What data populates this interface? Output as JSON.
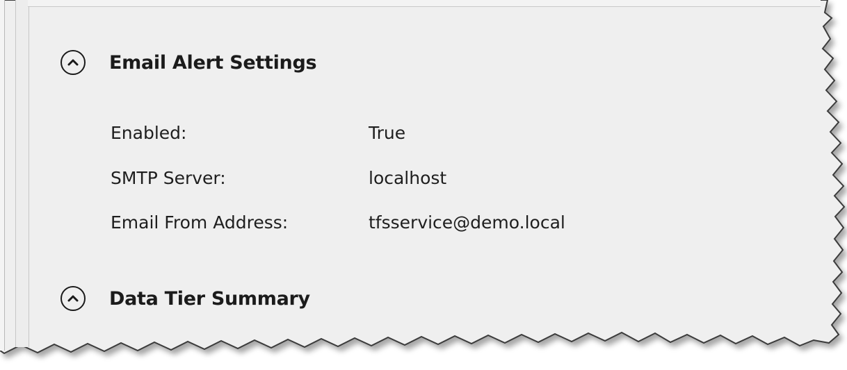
{
  "sections": [
    {
      "title": "Email Alert Settings",
      "expanded": true,
      "icon": "chevron-up-icon",
      "properties": [
        {
          "label": "Enabled:",
          "value": "True"
        },
        {
          "label": "SMTP Server:",
          "value": "localhost"
        },
        {
          "label": "Email From Address:",
          "value": "tfsservice@demo.local"
        }
      ]
    },
    {
      "title": "Data Tier Summary",
      "expanded": true,
      "icon": "chevron-up-icon"
    }
  ],
  "colors": {
    "panel_background": "#efefef",
    "text": "#1e1e1e",
    "border": "#4a4a4a"
  }
}
